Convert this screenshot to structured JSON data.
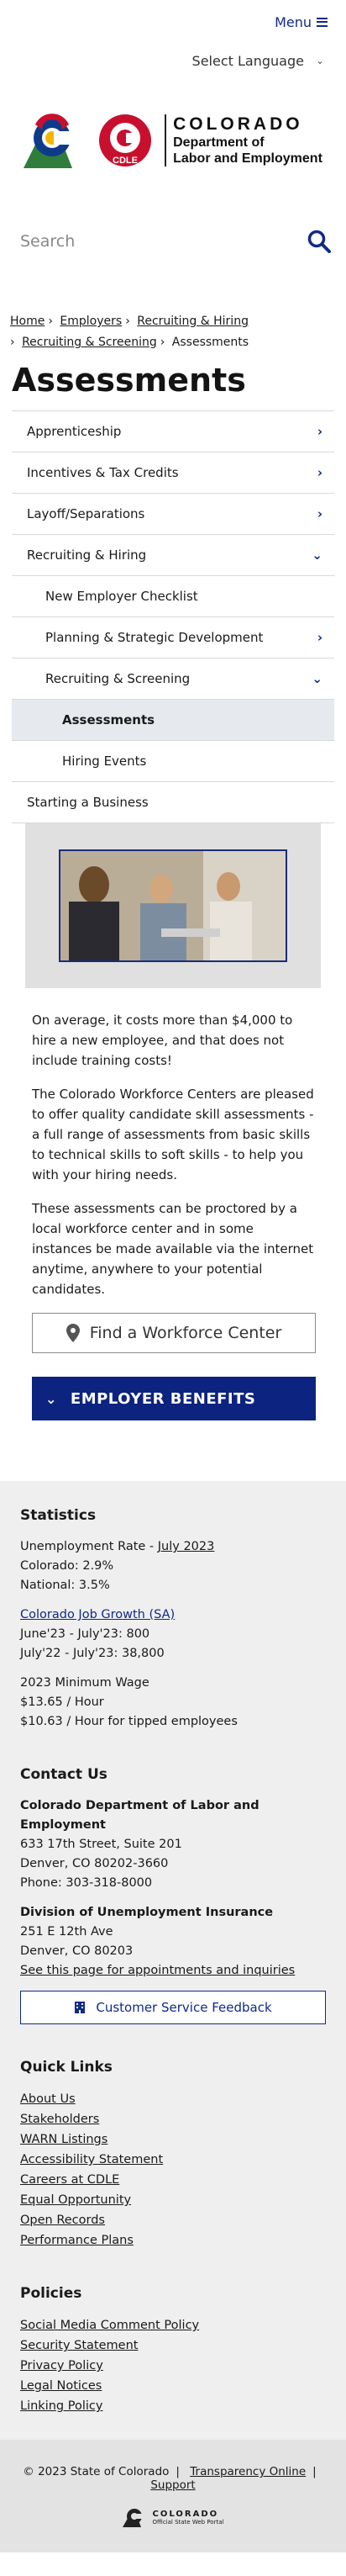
{
  "header": {
    "menu_label": "Menu",
    "language_label": "Select Language",
    "logo": {
      "state": "COLORADO",
      "dept_line1": "Department of",
      "dept_line2": "Labor and Employment",
      "badge": "CDLE"
    },
    "search_placeholder": "Search"
  },
  "breadcrumb": {
    "items": [
      "Home",
      "Employers",
      "Recruiting & Hiring",
      "Recruiting & Screening"
    ],
    "current": "Assessments"
  },
  "page_title": "Assessments",
  "sidenav": [
    {
      "label": "Apprenticeship",
      "level": 0,
      "arrow": "right"
    },
    {
      "label": "Incentives & Tax Credits",
      "level": 0,
      "arrow": "right"
    },
    {
      "label": "Layoff/Separations",
      "level": 0,
      "arrow": "right"
    },
    {
      "label": "Recruiting & Hiring",
      "level": 0,
      "arrow": "down"
    },
    {
      "label": "New Employer Checklist",
      "level": 1,
      "arrow": ""
    },
    {
      "label": "Planning & Strategic Development",
      "level": 1,
      "arrow": "right"
    },
    {
      "label": "Recruiting & Screening",
      "level": 1,
      "arrow": "down"
    },
    {
      "label": "Assessments",
      "level": 2,
      "arrow": "",
      "active": true
    },
    {
      "label": "Hiring Events",
      "level": 2,
      "arrow": ""
    },
    {
      "label": "Starting a Business",
      "level": 0,
      "arrow": ""
    }
  ],
  "content": {
    "p1": "On average, it costs more than $4,000 to hire a new employee, and that does not include training costs!",
    "p2": "The Colorado Workforce Centers are pleased to offer quality candidate skill assessments - a full range of assessments from basic skills to technical skills to soft skills - to help you with your hiring needs.",
    "p3": "These assessments can be proctored by a local workforce center and in some instances be made available via the internet anytime, anywhere to your potential candidates.",
    "find_button": "Find a Workforce Center",
    "accordion_label": "EMPLOYER BENEFITS"
  },
  "footer": {
    "statistics": {
      "heading": "Statistics",
      "unemp_label": "Unemployment Rate - ",
      "unemp_link": "July 2023",
      "colorado": "Colorado: 2.9%",
      "national": "National: 3.5%",
      "job_growth_link": "Colorado Job Growth (SA)",
      "jg1": "June'23 - July'23: 800",
      "jg2": "July'22 - July'23: 38,800",
      "min_wage_heading": "2023 Minimum Wage",
      "mw1": "$13.65 / Hour",
      "mw2": "$10.63 / Hour for tipped employees"
    },
    "contact": {
      "heading": "Contact Us",
      "org": "Colorado Department of Labor and Employment",
      "addr1": "633 17th Street, Suite 201",
      "addr2": "Denver, CO  80202-3660",
      "phone": "Phone: 303-318-8000",
      "ui_heading": "Division of Unemployment Insurance",
      "ui_addr1": "251 E 12th Ave",
      "ui_addr2": "Denver, CO  80203",
      "ui_link": "See this page for appointments and inquiries",
      "feedback_button": "Customer Service Feedback"
    },
    "quick_links": {
      "heading": "Quick Links",
      "items": [
        "About Us",
        "Stakeholders",
        "WARN Listings",
        "Accessibility Statement",
        "Careers at CDLE",
        "Equal Opportunity",
        "Open Records",
        "Performance Plans"
      ]
    },
    "policies": {
      "heading": "Policies",
      "items": [
        "Social Media Comment Policy",
        "Security Statement",
        "Privacy Policy",
        "Legal Notices",
        "Linking Policy"
      ]
    },
    "bottom": {
      "copyright": "© 2023 State of Colorado",
      "transparency": "Transparency Online",
      "support": "Support",
      "portal_line1": "COLORADO",
      "portal_line2": "Official State Web Portal"
    }
  },
  "colors": {
    "brand_blue": "#0c237f",
    "link_blue": "#0f2a8a",
    "footer_bg": "#efefef"
  }
}
